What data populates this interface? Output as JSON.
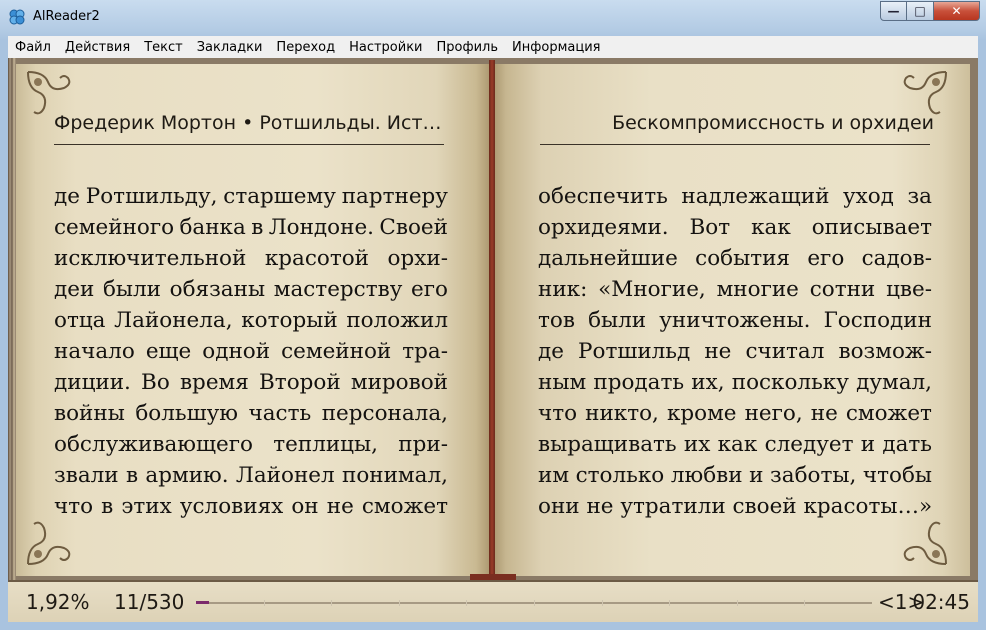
{
  "window": {
    "title": "AlReader2",
    "icon": "alreader-app-icon",
    "buttons": {
      "minimize": "—",
      "maximize": "□",
      "close": "✕"
    }
  },
  "menu": [
    {
      "label": "Файл"
    },
    {
      "label": "Действия"
    },
    {
      "label": "Текст"
    },
    {
      "label": "Закладки"
    },
    {
      "label": "Переход"
    },
    {
      "label": "Настройки"
    },
    {
      "label": "Профиль"
    },
    {
      "label": "Информация"
    }
  ],
  "book": {
    "left_header": "Фредерик Мортон  • Ротшильды. История…",
    "right_header": "Бескомпромиссность и орхидеи",
    "left_lines": [
      [
        "де",
        "Ротшильду,",
        "старшему",
        "партнеру"
      ],
      [
        "семейного",
        "банка",
        "в",
        "Лондоне.",
        "Своей"
      ],
      [
        "исключительной",
        "красотой",
        "орхи-"
      ],
      [
        "деи",
        "были",
        "обязаны",
        "мастерству",
        "его"
      ],
      [
        "отца",
        "Лайонела,",
        "который",
        "положил"
      ],
      [
        "начало",
        "еще",
        "одной",
        "семейной",
        "тра-"
      ],
      [
        "диции.",
        "Во",
        "время",
        "Второй",
        "мировой"
      ],
      [
        "войны",
        "большую",
        "часть",
        "персонала,"
      ],
      [
        "обслуживающего",
        "теплицы,",
        "при-"
      ],
      [
        "звали",
        "в",
        "армию.",
        "Лайонел",
        "понимал,"
      ],
      [
        "что",
        "в",
        "этих",
        "условиях",
        "он",
        "не",
        "сможет"
      ]
    ],
    "right_lines": [
      [
        "обеспечить",
        "надлежащий",
        "уход",
        "за"
      ],
      [
        "орхидеями.",
        "Вот",
        "как",
        "описывает"
      ],
      [
        "дальнейшие",
        "события",
        "его",
        "садов-"
      ],
      [
        "ник:",
        "«Многие,",
        "многие",
        "сотни",
        "цве-"
      ],
      [
        "тов",
        "были",
        "уничтожены.",
        "Господин"
      ],
      [
        "де",
        "Ротшильд",
        "не",
        "считал",
        "возмож-"
      ],
      [
        "ным",
        "продать",
        "их,",
        "поскольку",
        "думал,"
      ],
      [
        "что",
        "никто,",
        "кроме",
        "него,",
        "не",
        "сможет"
      ],
      [
        "выращивать",
        "их",
        "как",
        "следует",
        "и",
        "дать"
      ],
      [
        "им",
        "столько",
        "любви",
        "и",
        "заботы,",
        "чтобы"
      ],
      [
        "они не утратили своей красоты…»"
      ]
    ]
  },
  "status": {
    "percent": "1,92%",
    "pages": "11/530",
    "progress_fraction": 0.0192,
    "chapter": "<1>",
    "time": "02:45",
    "progress_color": "#7b2a6c"
  }
}
